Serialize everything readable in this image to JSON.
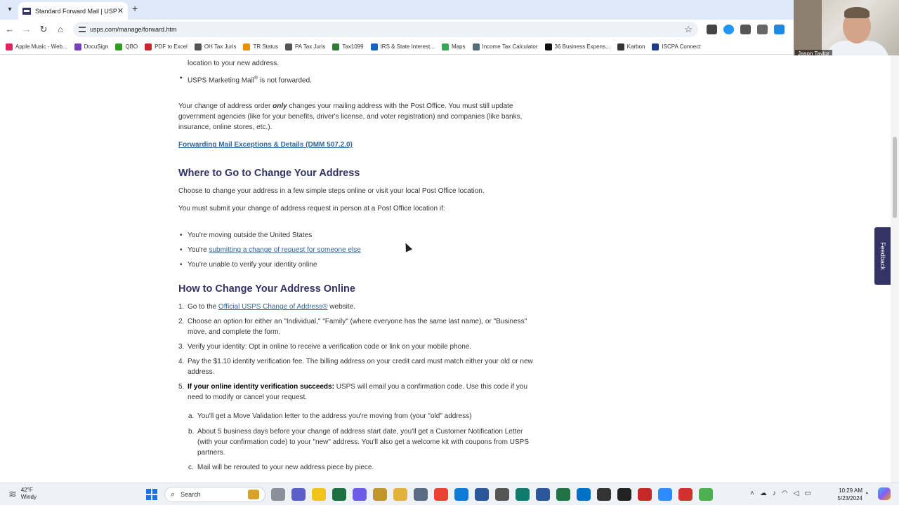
{
  "tab": {
    "title": "Standard Forward Mail | USPS",
    "close": "✕",
    "new": "+"
  },
  "toolbar": {
    "url": "usps.com/manage/forward.htm",
    "back": "←",
    "forward": "→",
    "reload": "↻",
    "home": "⌂",
    "star": "☆"
  },
  "bookmarks": [
    {
      "label": "Apple Music - Web...",
      "color": "#e0245e"
    },
    {
      "label": "DocuSign",
      "color": "#7a3fbd"
    },
    {
      "label": "QBO",
      "color": "#2ca01c"
    },
    {
      "label": "PDF to Excel",
      "color": "#c62828"
    },
    {
      "label": "OH Tax Juris",
      "color": "#555555"
    },
    {
      "label": "TR Status",
      "color": "#f28b00"
    },
    {
      "label": "PA Tax Juris",
      "color": "#555555"
    },
    {
      "label": "Tax1099",
      "color": "#2e7d32"
    },
    {
      "label": "IRS & State Interest...",
      "color": "#1565c0"
    },
    {
      "label": "Maps",
      "color": "#34a853"
    },
    {
      "label": "Income Tax Calculator",
      "color": "#546e7a"
    },
    {
      "label": "36 Business Expens...",
      "color": "#111111"
    },
    {
      "label": "Karbon",
      "color": "#333333"
    },
    {
      "label": "ISCPA Connect",
      "color": "#1e3a8a"
    }
  ],
  "webcam": {
    "name": "Jason Taylor"
  },
  "content": {
    "top_fragment": "location to your new address.",
    "marketing_mail_prefix": "USPS Marketing Mail",
    "marketing_mail_reg": "®",
    "marketing_mail_suffix": " is not forwarded.",
    "notice_part1": "Your change of address order ",
    "notice_only": "only",
    "notice_part2": " changes your mailing address with the Post Office. You must still update government agencies (like for your benefits, driver's license, and voter registration) and companies (like banks, insurance, online stores, etc.).",
    "exceptions_link": "Forwarding Mail Exceptions & Details (DMM 507.2.0)",
    "where_heading": "Where to Go to Change Your Address",
    "where_intro": "Choose to change your address in a few simple steps online or visit your local Post Office location.",
    "in_person_intro": "You must submit your change of address request in person at a Post Office location if:",
    "in_person_1": "You're moving outside the United States",
    "in_person_2_prefix": "You're ",
    "in_person_2_link": "submitting a change of request for someone else",
    "in_person_3": "You're unable to verify your identity online",
    "how_heading": "How to Change Your Address Online",
    "step1_prefix": "Go to the ",
    "step1_link": "Official USPS Change of Address®",
    "step1_suffix": " website.",
    "step2": "Choose an option for either an \"Individual,\" \"Family\" (where everyone has the same last name), or \"Business\" move, and complete the form.",
    "step3": "Verify your identity: Opt in online to receive a verification code or link on your mobile phone.",
    "step4": "Pay the $1.10 identity verification fee. The billing address on your credit card must match either your old or new address.",
    "step5_bold": "If your online identity verification succeeds:",
    "step5_rest": " USPS will email you a confirmation code. Use this code if you need to modify or cancel your request.",
    "sub_a": "You'll get a Move Validation letter to the address you're moving from (your \"old\" address)",
    "sub_b": "About 5 business days before your change of address start date, you'll get a Customer Notification Letter (with your confirmation code) to your \"new\" address. You'll also get a welcome kit with coupons from USPS partners.",
    "sub_c": "Mail will be rerouted to your new address piece by piece.",
    "num": [
      "1.",
      "2.",
      "3.",
      "4.",
      "5."
    ],
    "alpha": [
      "a.",
      "b.",
      "c."
    ]
  },
  "feedback": "Feedback",
  "taskbar": {
    "temp": "42°F",
    "condition": "Windy",
    "search_label": "Search",
    "time": "10:29 AM",
    "date": "5/23/2024",
    "app_colors": [
      "#8a8f99",
      "#5b5fc7",
      "#f0c419",
      "#1d6f42",
      "#6c5ce7",
      "#c0962b",
      "#e2b33c",
      "#5a6b82",
      "#ea4335",
      "#0f7bd8",
      "#2b579a",
      "#555555",
      "#0f7b6c",
      "#2b579a",
      "#217346",
      "#0072c6",
      "#333333",
      "#222222",
      "#c62828",
      "#2d8cff",
      "#d32f2f",
      "#4caf50"
    ]
  }
}
